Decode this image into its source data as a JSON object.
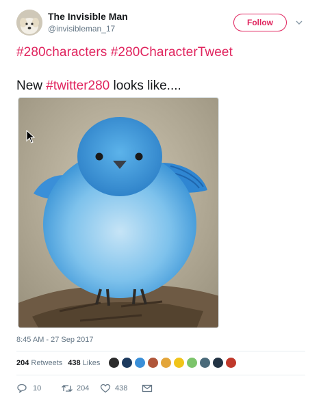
{
  "author": {
    "name": "The Invisible Man",
    "handle": "@invisibleman_17",
    "avatar_icon": "dog-avatar-icon"
  },
  "follow_label": "Follow",
  "tweet": {
    "hashtag_1": "#280characters",
    "hashtag_2": "#280CharacterTweet",
    "text_prefix": "New ",
    "hashtag_3": "#twitter280",
    "text_suffix": " looks like...."
  },
  "photo": {
    "subject": "bluebird-photo"
  },
  "timestamp": "8:45 AM - 27 Sep 2017",
  "stats": {
    "retweets_count": "204",
    "retweets_label": "Retweets",
    "likes_count": "438",
    "likes_label": "Likes"
  },
  "liker_avatars": 10,
  "actions": {
    "reply_count": "10",
    "retweet_count": "204",
    "like_count": "438"
  },
  "colors": {
    "hashtag": "#e0245e",
    "text": "#14171a",
    "secondary": "#657786"
  }
}
